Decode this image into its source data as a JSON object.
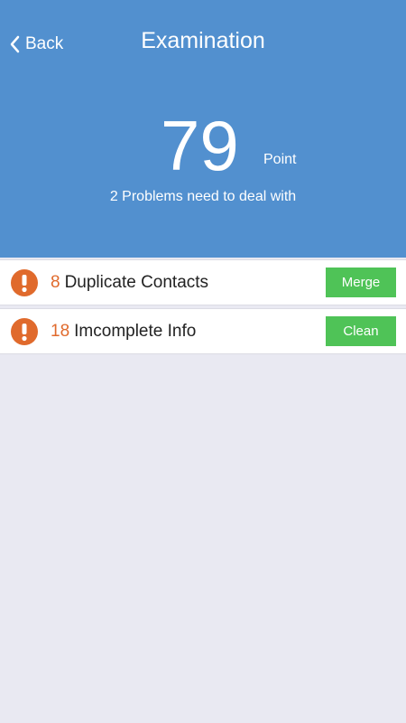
{
  "header": {
    "back_label": "Back",
    "title": "Examination",
    "score": "79",
    "score_unit": "Point",
    "subtitle": "2 Problems need to deal with"
  },
  "problems": [
    {
      "count": "8",
      "label": "Duplicate Contacts",
      "action": "Merge",
      "icon": "exclamation-icon"
    },
    {
      "count": "18",
      "label": "Imcomplete Info",
      "action": "Clean",
      "icon": "exclamation-icon"
    }
  ],
  "colors": {
    "header_bg": "#5290cf",
    "warning": "#e06a2c",
    "action": "#4fc357",
    "page_bg": "#e9e9f2"
  }
}
